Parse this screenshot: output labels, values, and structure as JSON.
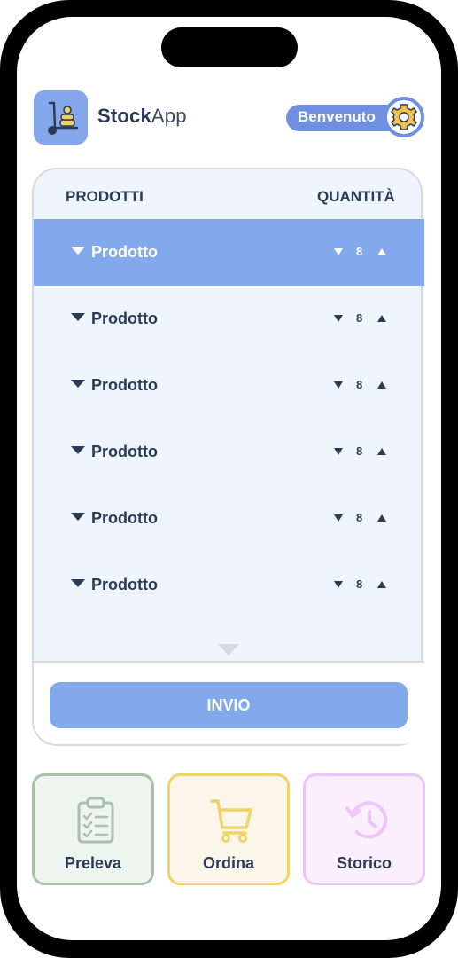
{
  "app": {
    "title_bold": "Stock",
    "title_light": "App"
  },
  "header": {
    "welcome_label": "Benvenuto"
  },
  "table": {
    "col_products": "PRODOTTI",
    "col_quantity": "QUANTITÀ",
    "rows": [
      {
        "name": "Prodotto",
        "qty": "8",
        "selected": true
      },
      {
        "name": "Prodotto",
        "qty": "8",
        "selected": false
      },
      {
        "name": "Prodotto",
        "qty": "8",
        "selected": false
      },
      {
        "name": "Prodotto",
        "qty": "8",
        "selected": false
      },
      {
        "name": "Prodotto",
        "qty": "8",
        "selected": false
      },
      {
        "name": "Prodotto",
        "qty": "8",
        "selected": false
      }
    ]
  },
  "send_label": "INVIO",
  "tiles": {
    "preleva": "Preleva",
    "ordina": "Ordina",
    "storico": "Storico"
  },
  "colors": {
    "accent": "#82a9ec",
    "welcome_pill": "#6f8fe0",
    "gear": "#f2c24d",
    "preleva_green": "#a8c1a8",
    "ordina_yellow": "#f0d468",
    "storico_pink": "#ecc6f6"
  },
  "icons": {
    "logo": "hand-truck-icon",
    "settings": "gear-icon",
    "preleva": "clipboard-checklist-icon",
    "ordina": "shopping-cart-icon",
    "storico": "history-clock-icon"
  }
}
